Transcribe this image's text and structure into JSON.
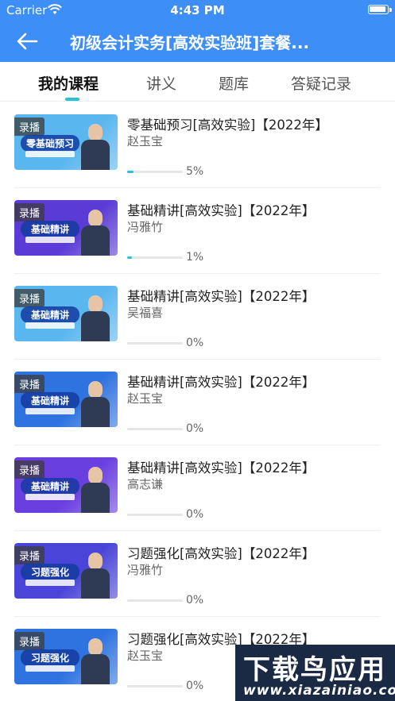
{
  "status_bar": {
    "carrier": "Carrier",
    "time": "4:43 PM"
  },
  "nav": {
    "title": "初级会计实务[高效实验班]套餐..."
  },
  "tabs": [
    {
      "label": "我的课程",
      "active": true
    },
    {
      "label": "讲义",
      "active": false
    },
    {
      "label": "题库",
      "active": false
    },
    {
      "label": "答疑记录",
      "active": false
    }
  ],
  "courses": [
    {
      "badge": "录播",
      "thumb_title": "零基础预习",
      "title": "零基础预习[高效实验]【2022年】",
      "teacher": "赵玉宝",
      "progress": 0.05,
      "progress_text": "5%",
      "theme": "#59b6ef"
    },
    {
      "badge": "录播",
      "thumb_title": "基础精讲",
      "title": "基础精讲[高效实验]【2022年】",
      "teacher": "冯雅竹",
      "progress": 0.01,
      "progress_text": "1%",
      "theme": "#5a3bd6"
    },
    {
      "badge": "录播",
      "thumb_title": "基础精讲",
      "title": "基础精讲[高效实验]【2022年】",
      "teacher": "吴福喜",
      "progress": 0,
      "progress_text": "0%",
      "theme": "#59b6ef"
    },
    {
      "badge": "录播",
      "thumb_title": "基础精讲",
      "title": "基础精讲[高效实验]【2022年】",
      "teacher": "赵玉宝",
      "progress": 0,
      "progress_text": "0%",
      "theme": "#2f73e0"
    },
    {
      "badge": "录播",
      "thumb_title": "基础精讲",
      "title": "基础精讲[高效实验]【2022年】",
      "teacher": "高志谦",
      "progress": 0,
      "progress_text": "0%",
      "theme": "#6a3fe0"
    },
    {
      "badge": "录播",
      "thumb_title": "习题强化",
      "title": "习题强化[高效实验]【2022年】",
      "teacher": "冯雅竹",
      "progress": 0,
      "progress_text": "0%",
      "theme": "#4a45d8"
    },
    {
      "badge": "录播",
      "thumb_title": "习题强化",
      "title": "习题强化[高效实验]【2022年】",
      "teacher": "赵玉宝",
      "progress": 0,
      "progress_text": "0%",
      "theme": "#2f73e0"
    }
  ],
  "watermark": {
    "main": "下载鸟应用",
    "sub": "www.xiazainiao.com"
  },
  "colors": {
    "primary": "#3e8ef7",
    "accent": "#27c0d8"
  }
}
